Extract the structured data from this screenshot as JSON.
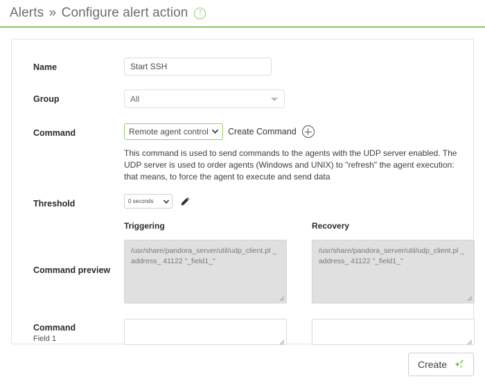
{
  "header": {
    "breadcrumb_root": "Alerts",
    "breadcrumb_separator": "»",
    "breadcrumb_current": "Configure alert action",
    "help_glyph": "?"
  },
  "form": {
    "name": {
      "label": "Name",
      "value": "Start SSH",
      "placeholder": ""
    },
    "group": {
      "label": "Group",
      "value": "All"
    },
    "command": {
      "label": "Command",
      "selected": "Remote agent control",
      "create_command_label": "Create Command",
      "description": "This command is used to send commands to the agents with the UDP server enabled. The UDP server is used to order agents (Windows and UNIX) to \"refresh\" the agent execution: that means, to force the agent to execute and send data"
    },
    "threshold": {
      "label": "Threshold",
      "value": "0 seconds"
    },
    "command_preview": {
      "label": "Command preview",
      "triggering_title": "Triggering",
      "recovery_title": "Recovery",
      "triggering_value": "/usr/share/pandora_server/util/udp_client.pl _address_ 41122 \"_field1_\"",
      "recovery_value": "/usr/share/pandora_server/util/udp_client.pl _address_ 41122 \"_field1_\""
    },
    "command_field": {
      "label": "Command",
      "sublabel": "Field 1",
      "triggering_value": "",
      "recovery_value": ""
    }
  },
  "footer": {
    "create_label": "Create"
  },
  "colors": {
    "accent_green": "#8ac35a",
    "help_green": "#9dc96c",
    "select_border_green": "#9dc96c",
    "preview_bg": "#e0e0e0"
  }
}
